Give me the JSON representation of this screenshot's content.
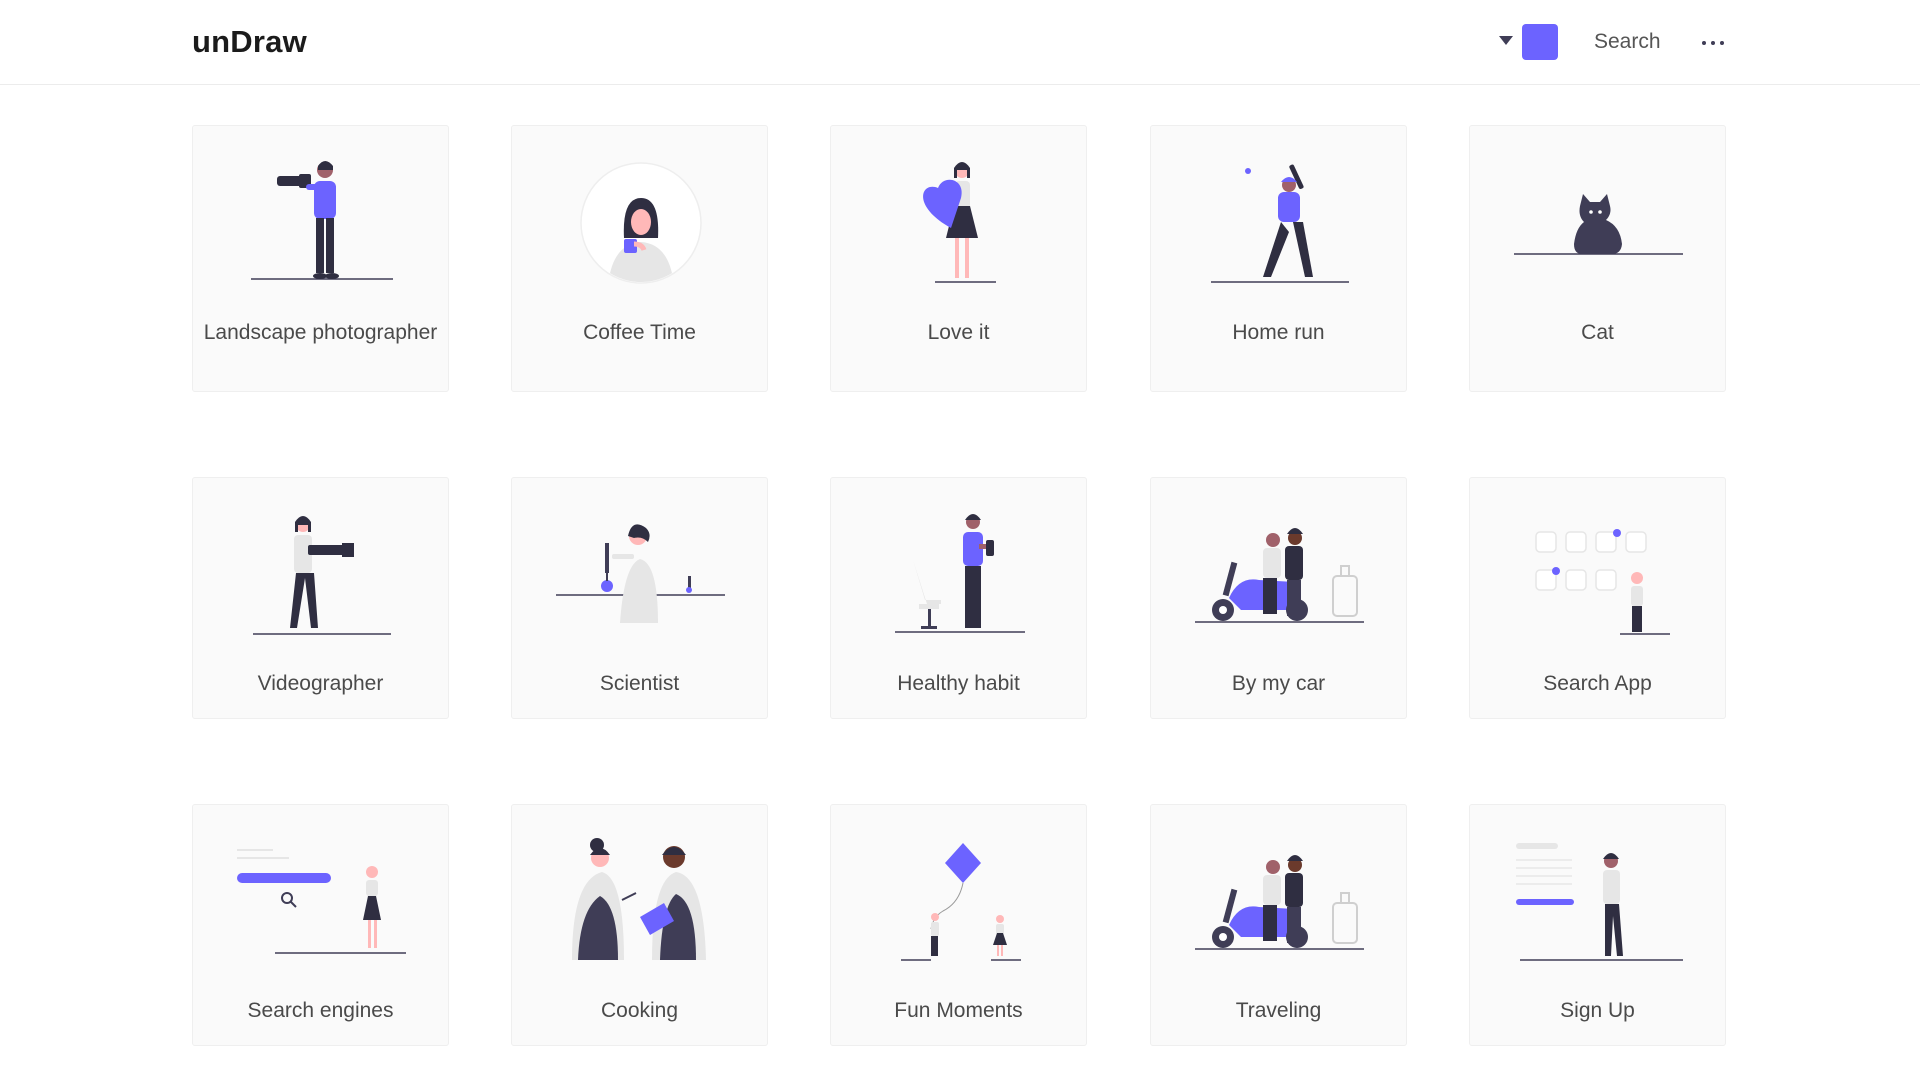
{
  "brand": {
    "logo": "unDraw",
    "accent_color": "#6c63ff"
  },
  "header": {
    "color_dropdown_icon": "caret-down-icon",
    "search_label": "Search",
    "more_icon": "more-horizontal-icon"
  },
  "illustrations": [
    {
      "title": "Landscape photographer",
      "icon": "photographer-illustration"
    },
    {
      "title": "Coffee Time",
      "icon": "coffee-illustration"
    },
    {
      "title": "Love it",
      "icon": "heart-illustration"
    },
    {
      "title": "Home run",
      "icon": "baseball-illustration"
    },
    {
      "title": "Cat",
      "icon": "cat-illustration"
    },
    {
      "title": "Videographer",
      "icon": "videographer-illustration"
    },
    {
      "title": "Scientist",
      "icon": "scientist-illustration"
    },
    {
      "title": "Healthy habit",
      "icon": "healthy-habit-illustration"
    },
    {
      "title": "By my car",
      "icon": "scooter-illustration"
    },
    {
      "title": "Search App",
      "icon": "search-app-illustration"
    },
    {
      "title": "Search engines",
      "icon": "search-engine-illustration"
    },
    {
      "title": "Cooking",
      "icon": "cooking-illustration"
    },
    {
      "title": "Fun Moments",
      "icon": "kite-illustration"
    },
    {
      "title": "Traveling",
      "icon": "traveling-illustration"
    },
    {
      "title": "Sign Up",
      "icon": "sign-up-illustration"
    }
  ]
}
